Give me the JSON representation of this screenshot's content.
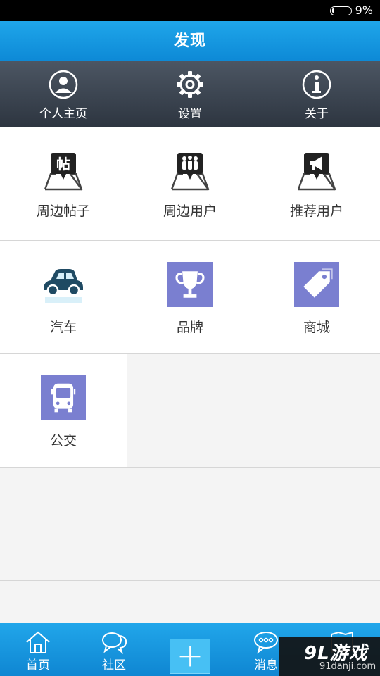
{
  "status_bar": {
    "battery": "9%"
  },
  "header": {
    "title": "发现"
  },
  "top_menu": [
    {
      "label": "个人主页",
      "icon": "profile-icon"
    },
    {
      "label": "设置",
      "icon": "gear-icon"
    },
    {
      "label": "关于",
      "icon": "info-icon"
    }
  ],
  "features": {
    "nearby_posts": "周边帖子",
    "nearby_users": "周边用户",
    "recommended_users": "推荐用户",
    "car": "汽车",
    "brand": "品牌",
    "mall": "商城",
    "bus": "公交"
  },
  "bottom_nav": {
    "home": "首页",
    "community": "社区",
    "messages": "消息"
  },
  "watermark": {
    "logo": "9L游戏",
    "url": "91danji.com"
  },
  "colors": {
    "header_blue": "#1fa6ea",
    "menu_dark": "#2d3540",
    "tile_purple": "#7a7fd0"
  }
}
